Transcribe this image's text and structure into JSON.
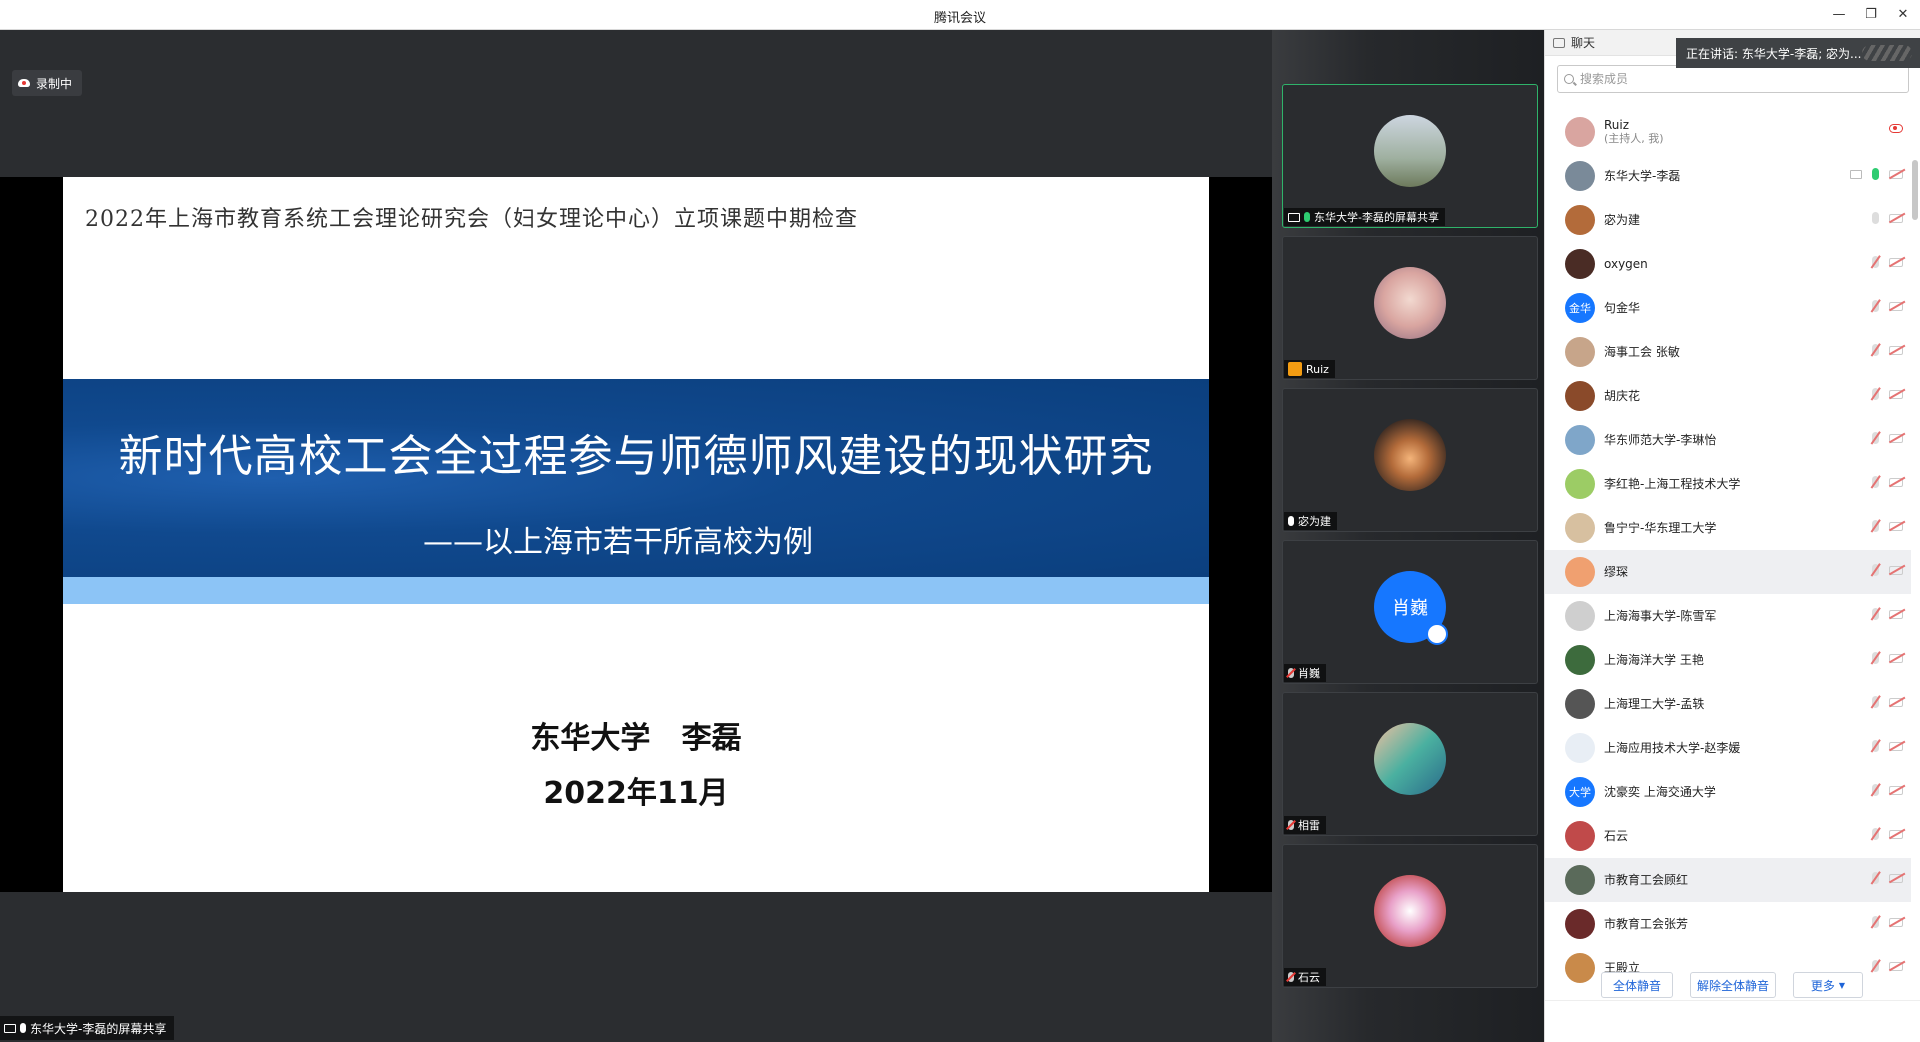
{
  "window": {
    "title": "腾讯会议"
  },
  "recording": {
    "label": "录制中"
  },
  "slide": {
    "header": "2022年上海市教育系统工会理论研究会（妇女理论中心）立项课题中期检查",
    "title": "新时代高校工会全过程参与师德师风建设的现状研究",
    "subtitle": "——以上海市若干所高校为例",
    "author": "东华大学   李磊",
    "date": "2022年11月"
  },
  "share_label": "东华大学-李磊的屏幕共享",
  "video_tiles": [
    {
      "name": "东华大学-李磊的屏幕共享",
      "icon": "screen-share-icon",
      "mic": "on"
    },
    {
      "name": "Ruiz",
      "icon": "user-icon",
      "mic": "none"
    },
    {
      "name": "宓为建",
      "icon": "mic-icon",
      "mic": "on"
    },
    {
      "name": "肖巍",
      "icon": "mic-muted-icon",
      "mic": "muted",
      "avatar_text": "肖巍"
    },
    {
      "name": "相雷",
      "icon": "mic-muted-icon",
      "mic": "muted"
    },
    {
      "name": "石云",
      "icon": "mic-muted-icon",
      "mic": "muted"
    }
  ],
  "panel": {
    "tab_label": "聊天",
    "speaking": "正在讲话: 东华大学-李磊; 宓为...",
    "search_placeholder": "搜索成员"
  },
  "members": [
    {
      "name": "Ruiz",
      "sub": "(主持人, 我)",
      "color": "#d9a5a0"
    },
    {
      "name": "东华大学-李磊",
      "color": "#7a8a99"
    },
    {
      "name": "宓为建",
      "color": "#b36b3a"
    },
    {
      "name": "oxygen",
      "color": "#4a2c25"
    },
    {
      "name": "句金华",
      "avatar_text": "金华",
      "color": "#1677ff"
    },
    {
      "name": "海事工会  张敏",
      "color": "#c7a58a"
    },
    {
      "name": "胡庆花",
      "color": "#8a4a2a"
    },
    {
      "name": "华东师范大学-李琳怡",
      "color": "#7fa6c9"
    },
    {
      "name": "李红艳-上海工程技术大学",
      "color": "#9ccc65"
    },
    {
      "name": "鲁宁宁-华东理工大学",
      "color": "#d7c0a0"
    },
    {
      "name": "缪琛",
      "color": "#f0a070"
    },
    {
      "name": "上海海事大学-陈雪军",
      "color": "#cfcfcf"
    },
    {
      "name": "上海海洋大学  王艳",
      "color": "#3d6b3d"
    },
    {
      "name": "上海理工大学-孟轶",
      "color": "#555555"
    },
    {
      "name": "上海应用技术大学-赵李媛",
      "color": "#e8eef5"
    },
    {
      "name": "沈豪奕 上海交通大学",
      "avatar_text": "大学",
      "color": "#1677ff"
    },
    {
      "name": "石云",
      "color": "#c04a4a"
    },
    {
      "name": "市教育工会顾红",
      "color": "#5a6a5a"
    },
    {
      "name": "市教育工会张芳",
      "color": "#6a2a2a"
    },
    {
      "name": "王殿立",
      "color": "#c98a4a"
    }
  ],
  "footer": {
    "mute_all": "全体静音",
    "unmute_all": "解除全体静音",
    "more": "更多"
  },
  "colors": {
    "accent": "#1e64d8",
    "active_tile": "#2fb36a",
    "slide_band": "#10498e",
    "slide_band2": "#8cc4f6"
  }
}
